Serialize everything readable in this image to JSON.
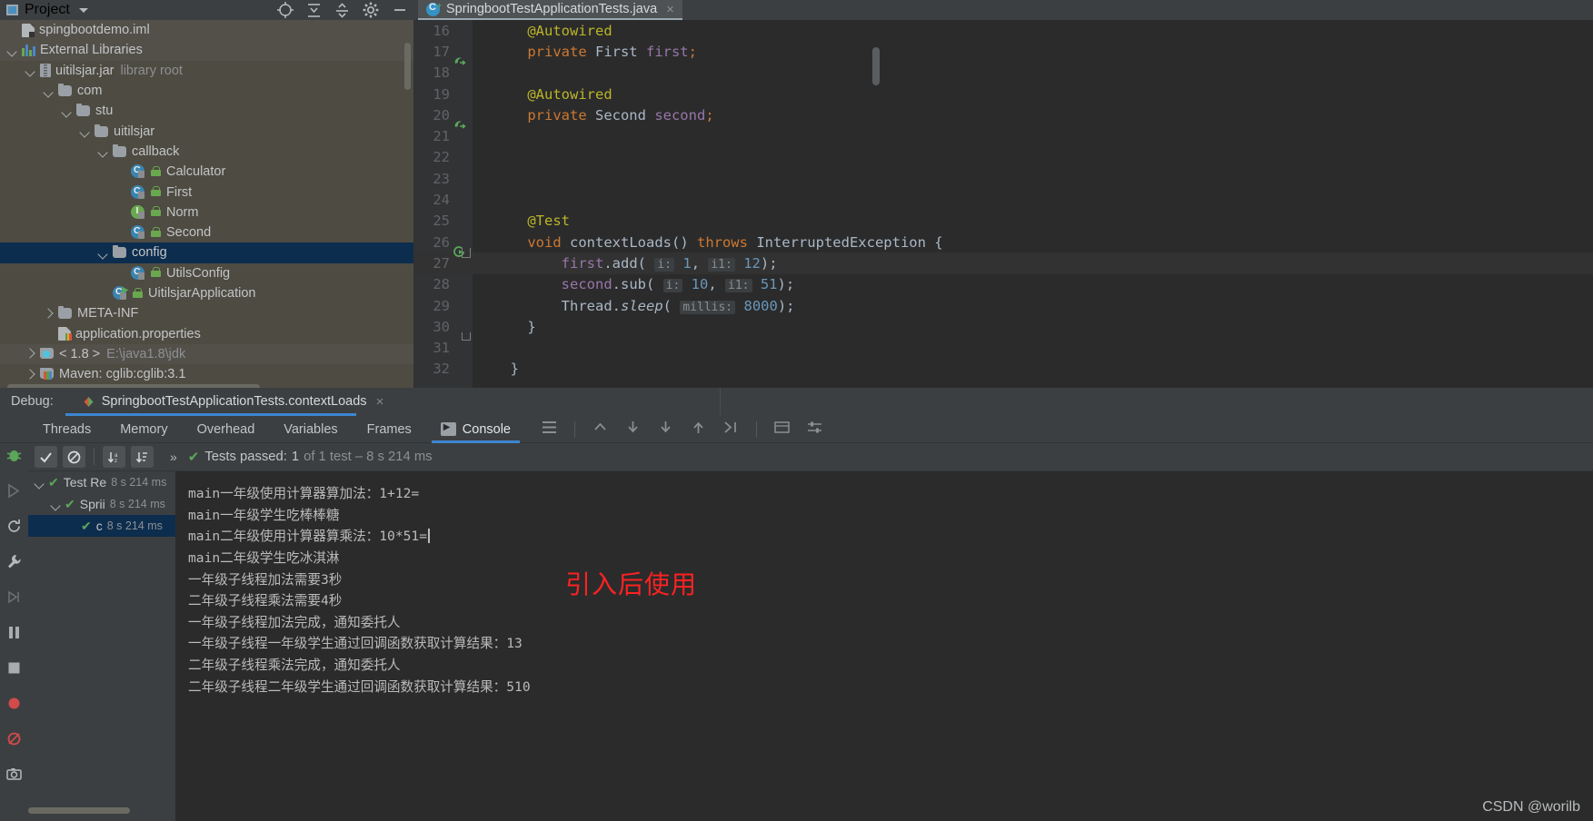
{
  "window": {
    "project_panel_title": "Project",
    "toolbar_icons": [
      "locate-icon",
      "expand-all-icon",
      "collapse-all-icon",
      "gear-icon",
      "minimize-icon"
    ]
  },
  "editor_tab": {
    "label": "SpringbootTestApplicationTests.java",
    "close_label": "×",
    "icon": "java-test-class-icon"
  },
  "project_tree": [
    {
      "indent": 0,
      "arrow": "none",
      "icon": "iml-file-icon",
      "label": "spingbootdemo.iml",
      "suffix": "",
      "state": "highlight"
    },
    {
      "indent": 0,
      "arrow": "down",
      "icon": "library-icon",
      "label": "External Libraries",
      "suffix": "",
      "state": "highlight"
    },
    {
      "indent": 1,
      "arrow": "down",
      "icon": "jar-icon",
      "label": "uitilsjar.jar",
      "suffix": "library root",
      "state": "normal"
    },
    {
      "indent": 2,
      "arrow": "down",
      "icon": "folder-icon",
      "label": "com",
      "suffix": "",
      "state": "normal"
    },
    {
      "indent": 3,
      "arrow": "down",
      "icon": "folder-icon",
      "label": "stu",
      "suffix": "",
      "state": "normal"
    },
    {
      "indent": 4,
      "arrow": "down",
      "icon": "folder-icon",
      "label": "uitilsjar",
      "suffix": "",
      "state": "normal"
    },
    {
      "indent": 5,
      "arrow": "down",
      "icon": "folder-icon",
      "label": "callback",
      "suffix": "",
      "state": "normal"
    },
    {
      "indent": 6,
      "arrow": "none",
      "icon": "class-icon",
      "label": "Calculator",
      "suffix": "",
      "state": "normal",
      "lock": true
    },
    {
      "indent": 6,
      "arrow": "none",
      "icon": "class-icon",
      "label": "First",
      "suffix": "",
      "state": "normal",
      "lock": true
    },
    {
      "indent": 6,
      "arrow": "none",
      "icon": "interface-icon",
      "label": "Norm",
      "suffix": "",
      "state": "normal",
      "lock": true
    },
    {
      "indent": 6,
      "arrow": "none",
      "icon": "class-icon",
      "label": "Second",
      "suffix": "",
      "state": "normal",
      "lock": true
    },
    {
      "indent": 5,
      "arrow": "down",
      "icon": "folder-icon",
      "label": "config",
      "suffix": "",
      "state": "selected"
    },
    {
      "indent": 6,
      "arrow": "none",
      "icon": "class-icon",
      "label": "UtilsConfig",
      "suffix": "",
      "state": "normal",
      "lock": true
    },
    {
      "indent": 5,
      "arrow": "none",
      "icon": "class-run-icon",
      "label": "UitilsjarApplication",
      "suffix": "",
      "state": "normal",
      "lock": true
    },
    {
      "indent": 2,
      "arrow": "right",
      "icon": "folder-icon",
      "label": "META-INF",
      "suffix": "",
      "state": "normal"
    },
    {
      "indent": 2,
      "arrow": "none",
      "icon": "properties-icon",
      "label": "application.properties",
      "suffix": "",
      "state": "normal"
    },
    {
      "indent": 1,
      "arrow": "right",
      "icon": "jdk-icon",
      "label": "< 1.8 >",
      "suffix": "E:\\java1.8\\jdk",
      "state": "highlight"
    },
    {
      "indent": 1,
      "arrow": "right",
      "icon": "maven-icon",
      "label": "Maven: cglib:cglib:3.1",
      "suffix": "",
      "state": "normal"
    }
  ],
  "code_lines": [
    {
      "no": "16",
      "indent": 4,
      "gutter": "",
      "fold": "",
      "tokens": [
        {
          "t": "@Autowired",
          "c": "ann"
        }
      ]
    },
    {
      "no": "17",
      "indent": 4,
      "gutter": "bean",
      "fold": "",
      "tokens": [
        {
          "t": "private ",
          "c": "kw"
        },
        {
          "t": "First ",
          "c": "cls2"
        },
        {
          "t": "first",
          "c": "fld"
        },
        {
          "t": ";",
          "c": "kw"
        }
      ]
    },
    {
      "no": "18",
      "indent": 4,
      "gutter": "",
      "fold": "",
      "tokens": []
    },
    {
      "no": "19",
      "indent": 4,
      "gutter": "",
      "fold": "",
      "tokens": [
        {
          "t": "@Autowired",
          "c": "ann"
        }
      ]
    },
    {
      "no": "20",
      "indent": 4,
      "gutter": "bean",
      "fold": "",
      "tokens": [
        {
          "t": "private ",
          "c": "kw"
        },
        {
          "t": "Second ",
          "c": "cls2"
        },
        {
          "t": "second",
          "c": "fld"
        },
        {
          "t": ";",
          "c": "kw"
        }
      ]
    },
    {
      "no": "21",
      "indent": 4,
      "gutter": "",
      "fold": "",
      "tokens": []
    },
    {
      "no": "22",
      "indent": 4,
      "gutter": "",
      "fold": "",
      "tokens": []
    },
    {
      "no": "23",
      "indent": 4,
      "gutter": "",
      "fold": "",
      "tokens": []
    },
    {
      "no": "24",
      "indent": 4,
      "gutter": "",
      "fold": "",
      "tokens": []
    },
    {
      "no": "25",
      "indent": 4,
      "gutter": "",
      "fold": "",
      "tokens": [
        {
          "t": "@Test",
          "c": "ann"
        }
      ]
    },
    {
      "no": "26",
      "indent": 4,
      "gutter": "run",
      "fold": "start",
      "tokens": [
        {
          "t": "void ",
          "c": "kw"
        },
        {
          "t": "contextLoads",
          "c": "mth"
        },
        {
          "t": "() ",
          "c": "cls2"
        },
        {
          "t": "throws ",
          "c": "kw"
        },
        {
          "t": "InterruptedException",
          "c": "cls2"
        },
        {
          "t": " {",
          "c": "cls2"
        }
      ]
    },
    {
      "no": "27",
      "indent": 8,
      "gutter": "",
      "fold": "",
      "current": true,
      "tokens": [
        {
          "t": "first",
          "c": "fld"
        },
        {
          "t": ".",
          "c": "cls2"
        },
        {
          "t": "add",
          "c": "mth"
        },
        {
          "t": "( ",
          "c": "cls2"
        },
        {
          "t": "i:",
          "c": "hint"
        },
        {
          "t": " ",
          "c": "cls2"
        },
        {
          "t": "1",
          "c": "num"
        },
        {
          "t": ", ",
          "c": "cls2"
        },
        {
          "t": "i1:",
          "c": "hint"
        },
        {
          "t": " ",
          "c": "cls2"
        },
        {
          "t": "12",
          "c": "num"
        },
        {
          "t": ");",
          "c": "cls2"
        }
      ]
    },
    {
      "no": "28",
      "indent": 8,
      "gutter": "",
      "fold": "",
      "tokens": [
        {
          "t": "second",
          "c": "fld"
        },
        {
          "t": ".",
          "c": "cls2"
        },
        {
          "t": "sub",
          "c": "mth"
        },
        {
          "t": "( ",
          "c": "cls2"
        },
        {
          "t": "i:",
          "c": "hint"
        },
        {
          "t": " ",
          "c": "cls2"
        },
        {
          "t": "10",
          "c": "num"
        },
        {
          "t": ", ",
          "c": "cls2"
        },
        {
          "t": "i1:",
          "c": "hint"
        },
        {
          "t": " ",
          "c": "cls2"
        },
        {
          "t": "51",
          "c": "num"
        },
        {
          "t": ");",
          "c": "cls2"
        }
      ]
    },
    {
      "no": "29",
      "indent": 8,
      "gutter": "",
      "fold": "",
      "tokens": [
        {
          "t": "Thread",
          "c": "cls2"
        },
        {
          "t": ".",
          "c": "cls2"
        },
        {
          "t": "sleep",
          "c": "mthi"
        },
        {
          "t": "( ",
          "c": "cls2"
        },
        {
          "t": "millis:",
          "c": "hint"
        },
        {
          "t": " ",
          "c": "cls2"
        },
        {
          "t": "8000",
          "c": "num"
        },
        {
          "t": ");",
          "c": "cls2"
        }
      ]
    },
    {
      "no": "30",
      "indent": 4,
      "gutter": "",
      "fold": "end",
      "tokens": [
        {
          "t": "}",
          "c": "cls2"
        }
      ]
    },
    {
      "no": "31",
      "indent": 4,
      "gutter": "",
      "fold": "",
      "tokens": []
    },
    {
      "no": "32",
      "indent": 2,
      "gutter": "",
      "fold": "",
      "tokens": [
        {
          "t": "}",
          "c": "cls2"
        }
      ]
    }
  ],
  "debug_header": {
    "label": "Debug:",
    "tab_label": "SpringbootTestApplicationTests.contextLoads",
    "tab_close": "×"
  },
  "debug_tabs": [
    {
      "label": "Threads",
      "active": false,
      "icon": ""
    },
    {
      "label": "Memory",
      "active": false,
      "icon": ""
    },
    {
      "label": "Overhead",
      "active": false,
      "icon": ""
    },
    {
      "label": "Variables",
      "active": false,
      "icon": ""
    },
    {
      "label": "Frames",
      "active": false,
      "icon": ""
    },
    {
      "label": "Console",
      "active": true,
      "icon": "console-icon"
    }
  ],
  "test_toolbar": {
    "buttons": [
      "show-passed-icon",
      "hide-ignored-icon",
      "sort-alphabetically-icon",
      "sort-by-duration-icon"
    ],
    "more_label": "»",
    "status_prefix": "Tests passed:",
    "status_count": "1",
    "status_suffix": "of 1 test – 8 s 214 ms"
  },
  "test_tree": [
    {
      "indent": 0,
      "arrow": "down",
      "label": "Test Re",
      "time": "8 s 214 ms",
      "selected": false
    },
    {
      "indent": 1,
      "arrow": "down",
      "label": "Sprii",
      "time": "8 s 214 ms",
      "selected": false
    },
    {
      "indent": 2,
      "arrow": "none",
      "label": "c",
      "time": "8 s 214 ms",
      "selected": true
    }
  ],
  "console_lines": [
    "main一年级使用计算器算加法：1+12=",
    "main一年级学生吃棒棒糖",
    "main二年级使用计算器算乘法：10*51=",
    "main二年级学生吃冰淇淋",
    "一年级子线程加法需要3秒",
    "二年级子线程乘法需要4秒",
    "一年级子线程加法完成，通知委托人",
    "一年级子线程一年级学生通过回调函数获取计算结果：13",
    "二年级子线程乘法完成，通知委托人",
    "二年级子线程二年级学生通过回调函数获取计算结果：510"
  ],
  "annotation": "引入后使用",
  "watermark": "CSDN @worilb",
  "colors": {
    "accent_blue": "#3d86d1",
    "selection": "#0d2d4e",
    "tree_bg": "#4e4b42",
    "editor_bg": "#2b2b2b",
    "annotation_red": "#fc2222"
  }
}
